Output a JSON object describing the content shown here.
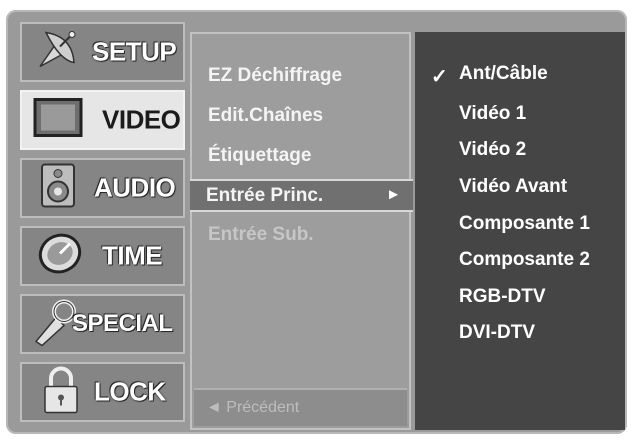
{
  "categories": [
    {
      "label": "SETUP",
      "icon": "satellite-dish-icon",
      "selected": false
    },
    {
      "label": "VIDEO",
      "icon": "video-screen-icon",
      "selected": true
    },
    {
      "label": "AUDIO",
      "icon": "speaker-icon",
      "selected": false
    },
    {
      "label": "TIME",
      "icon": "clock-icon",
      "selected": false
    },
    {
      "label": "SPECIAL",
      "icon": "key-icon",
      "selected": false
    },
    {
      "label": "LOCK",
      "icon": "padlock-icon",
      "selected": false
    }
  ],
  "submenu": {
    "items": [
      {
        "label": "EZ Déchiffrage"
      },
      {
        "label": "Edit.Chaînes"
      },
      {
        "label": "Étiquettage"
      },
      {
        "label": "Entrée Princ.",
        "highlighted": true
      },
      {
        "label": "Entrée Sub.",
        "dim": true
      }
    ],
    "arrow": "►",
    "back_label": "◄ Précédent"
  },
  "options": {
    "checkmark": "✓",
    "selected_index": 0,
    "items": [
      {
        "label": "Ant/Câble"
      },
      {
        "label": "Vidéo 1"
      },
      {
        "label": "Vidéo 2"
      },
      {
        "label": "Vidéo Avant"
      },
      {
        "label": "Composante 1"
      },
      {
        "label": "Composante 2"
      },
      {
        "label": "RGB-DTV"
      },
      {
        "label": "DVI-DTV"
      }
    ]
  },
  "colors": {
    "osd_background": "#9a9a9a",
    "selected_category": "#e6e6e6",
    "option_panel": "#454545",
    "highlight": "#707070"
  }
}
